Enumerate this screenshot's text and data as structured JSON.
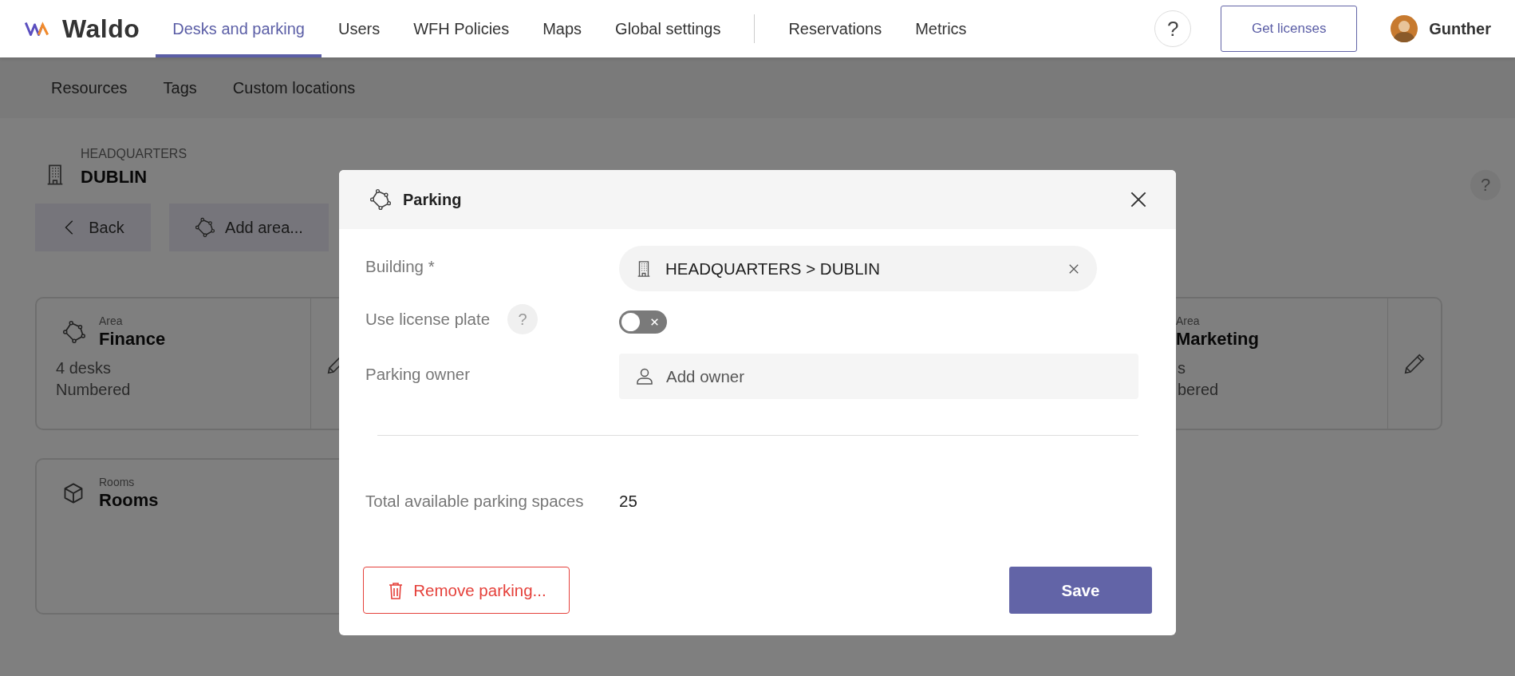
{
  "app": {
    "logo": "Waldo"
  },
  "nav": {
    "tabs": [
      {
        "label": "Desks and parking",
        "selected": true
      },
      {
        "label": "Users",
        "selected": false
      },
      {
        "label": "WFH Policies",
        "selected": false
      },
      {
        "label": "Maps",
        "selected": false
      },
      {
        "label": "Global settings",
        "selected": false
      }
    ],
    "more_tabs": [
      {
        "label": "Reservations",
        "selected": false
      },
      {
        "label": "Metrics",
        "selected": false
      }
    ],
    "help": "?",
    "get_licenses": "Get licenses",
    "user": "Gunther"
  },
  "subnav": [
    {
      "label": "Resources"
    },
    {
      "label": "Tags"
    },
    {
      "label": "Custom locations"
    }
  ],
  "location": {
    "parent": "HEADQUARTERS",
    "name": "DUBLIN",
    "help": "?"
  },
  "actions": [
    {
      "label": "Back",
      "kind": "back"
    },
    {
      "label": "Add area...",
      "kind": "area"
    }
  ],
  "cards": [
    {
      "kind": "area",
      "label": "Area",
      "title": "Finance",
      "lines": [
        "4 desks",
        "Numbered"
      ]
    },
    {
      "kind": "area",
      "label": "Area",
      "title": "Marketing",
      "lines": [
        "s",
        "bered"
      ]
    },
    {
      "kind": "rooms",
      "label": "Rooms",
      "title": "Rooms"
    }
  ],
  "dialog": {
    "title": "Parking",
    "fields": [
      {
        "kind": "building",
        "label": "Building *",
        "value": "HEADQUARTERS > DUBLIN"
      },
      {
        "kind": "toggle",
        "label": "Use license plate",
        "help": "?",
        "on": false
      },
      {
        "kind": "owner",
        "label": "Parking owner",
        "placeholder": "Add owner"
      }
    ],
    "total": {
      "label": "Total available parking spaces",
      "value": "25"
    },
    "remove": "Remove parking...",
    "save": "Save"
  }
}
